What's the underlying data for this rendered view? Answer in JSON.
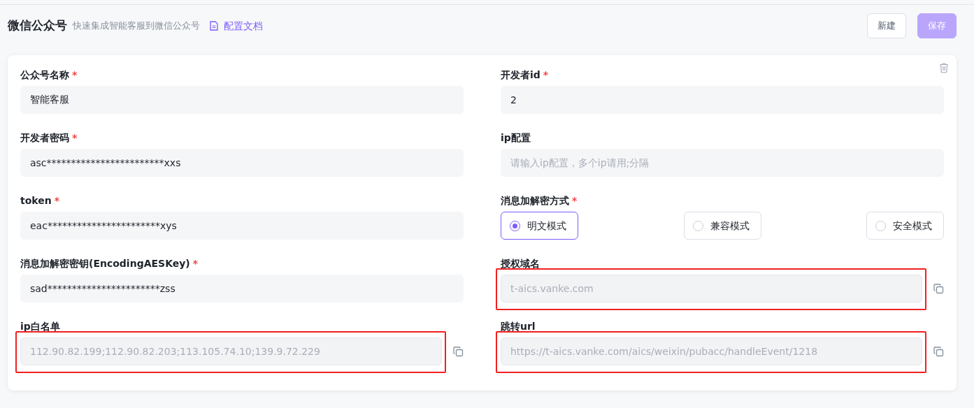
{
  "header": {
    "title": "微信公众号",
    "subtitle": "快速集成智能客服到微信公众号",
    "doc_link": "配置文档"
  },
  "buttons": [
    {
      "label": "新建",
      "kind": "secondary"
    },
    {
      "label": "保存",
      "kind": "primary",
      "disabled": true
    }
  ],
  "form": {
    "left": [
      {
        "kind": "text",
        "label": "公众号名称",
        "required_mark": "*",
        "value": "智能客服"
      },
      {
        "kind": "text",
        "label": "开发者密码",
        "required_mark": "*",
        "value": "asc************************xxs"
      },
      {
        "kind": "text",
        "label": "token",
        "required_mark": "*",
        "value": "eac***********************xys"
      },
      {
        "kind": "text",
        "label": "消息加解密密钥(EncodingAESKey)",
        "required_mark": "*",
        "value": "sad***********************zss"
      },
      {
        "kind": "readonly",
        "label": "ip白名单",
        "value": "112.90.82.199;112.90.82.203;113.105.74.10;139.9.72.229",
        "highlighted": true
      }
    ],
    "right": [
      {
        "kind": "text",
        "label": "开发者id",
        "required_mark": "*",
        "value": "2"
      },
      {
        "kind": "text",
        "label": "ip配置",
        "placeholder": "请输入ip配置，多个ip请用;分隔"
      },
      {
        "kind": "radio",
        "label": "消息加解密方式",
        "required_mark": "*",
        "options": [
          {
            "label": "明文模式",
            "selected": true
          },
          {
            "label": "兼容模式",
            "selected": false
          },
          {
            "label": "安全模式",
            "selected": false
          }
        ]
      },
      {
        "kind": "readonly",
        "label": "授权域名",
        "value": "t-aics.vanke.com",
        "highlighted": true
      },
      {
        "kind": "readonly",
        "label": "跳转url",
        "value": "https://t-aics.vanke.com/aics/weixin/pubacc/handleEvent/1218",
        "highlighted": true
      }
    ]
  }
}
